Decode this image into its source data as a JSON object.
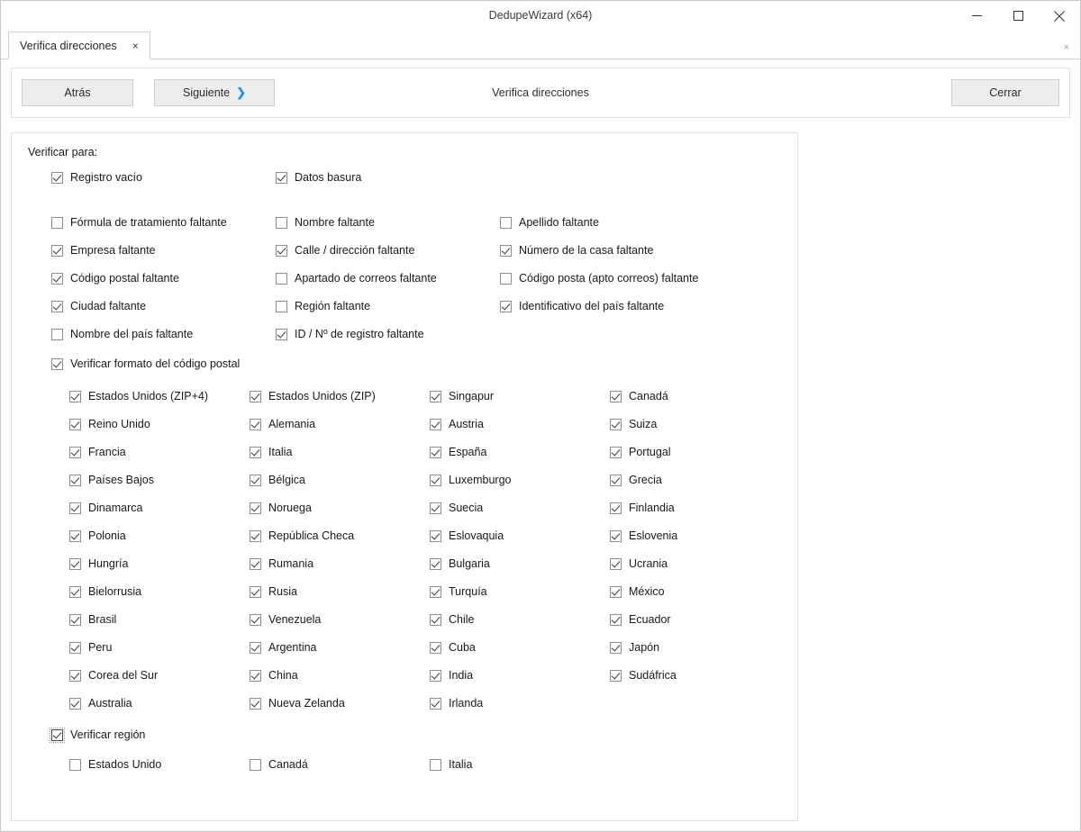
{
  "window": {
    "title": "DedupeWizard  (x64)",
    "minimize_label": "minimize",
    "maximize_label": "maximize",
    "close_label": "close"
  },
  "tabstrip": {
    "tab_label": "Verifica direcciones",
    "tab_close": "×",
    "strip_close": "×"
  },
  "toolbar": {
    "back_label": "Atrás",
    "next_label": "Siguiente",
    "next_chevron": "❯",
    "title": "Verifica direcciones",
    "close_label": "Cerrar"
  },
  "main": {
    "verify_for_label": "Verificar para:",
    "top_checks": [
      {
        "label": "Registro vacío",
        "checked": true
      },
      {
        "label": "Datos basura",
        "checked": true
      },
      {
        "label": "",
        "checked": null
      },
      {
        "label": "Fórmula de tratamiento faltante",
        "checked": false
      },
      {
        "label": "Nombre faltante",
        "checked": false
      },
      {
        "label": "Apellido faltante",
        "checked": false
      },
      {
        "label": "Empresa faltante",
        "checked": true
      },
      {
        "label": "Calle / dirección faltante",
        "checked": true
      },
      {
        "label": "Número de la casa faltante",
        "checked": true
      },
      {
        "label": "Código postal faltante",
        "checked": true
      },
      {
        "label": "Apartado de correos faltante",
        "checked": false
      },
      {
        "label": "Código posta (apto correos) faltante",
        "checked": false
      },
      {
        "label": "Ciudad faltante",
        "checked": true
      },
      {
        "label": "Región faltante",
        "checked": false
      },
      {
        "label": "Identificativo del país faltante",
        "checked": true
      },
      {
        "label": "Nombre del país faltante",
        "checked": false
      },
      {
        "label": "ID / Nº de registro faltante",
        "checked": true
      },
      {
        "label": "",
        "checked": null
      }
    ],
    "zip_format": {
      "label": "Verificar formato del código postal",
      "checked": true
    },
    "countries": [
      {
        "label": "Estados Unidos (ZIP+4)",
        "checked": true
      },
      {
        "label": "Estados Unidos (ZIP)",
        "checked": true
      },
      {
        "label": "Singapur",
        "checked": true
      },
      {
        "label": "Canadá",
        "checked": true
      },
      {
        "label": "Reino Unido",
        "checked": true
      },
      {
        "label": "Alemania",
        "checked": true
      },
      {
        "label": "Austria",
        "checked": true
      },
      {
        "label": "Suiza",
        "checked": true
      },
      {
        "label": "Francia",
        "checked": true
      },
      {
        "label": "Italia",
        "checked": true
      },
      {
        "label": "España",
        "checked": true
      },
      {
        "label": "Portugal",
        "checked": true
      },
      {
        "label": "Países Bajos",
        "checked": true
      },
      {
        "label": "Bélgica",
        "checked": true
      },
      {
        "label": "Luxemburgo",
        "checked": true
      },
      {
        "label": "Grecia",
        "checked": true
      },
      {
        "label": "Dinamarca",
        "checked": true
      },
      {
        "label": "Noruega",
        "checked": true
      },
      {
        "label": "Suecia",
        "checked": true
      },
      {
        "label": "Finlandia",
        "checked": true
      },
      {
        "label": "Polonia",
        "checked": true
      },
      {
        "label": "República Checa",
        "checked": true
      },
      {
        "label": "Eslovaquia",
        "checked": true
      },
      {
        "label": "Eslovenia",
        "checked": true
      },
      {
        "label": "Hungría",
        "checked": true
      },
      {
        "label": "Rumania",
        "checked": true
      },
      {
        "label": "Bulgaria",
        "checked": true
      },
      {
        "label": "Ucrania",
        "checked": true
      },
      {
        "label": "Bielorrusia",
        "checked": true
      },
      {
        "label": "Rusia",
        "checked": true
      },
      {
        "label": "Turquía",
        "checked": true
      },
      {
        "label": "México",
        "checked": true
      },
      {
        "label": "Brasil",
        "checked": true
      },
      {
        "label": "Venezuela",
        "checked": true
      },
      {
        "label": "Chile",
        "checked": true
      },
      {
        "label": "Ecuador",
        "checked": true
      },
      {
        "label": "Peru",
        "checked": true
      },
      {
        "label": "Argentina",
        "checked": true
      },
      {
        "label": "Cuba",
        "checked": true
      },
      {
        "label": "Japón",
        "checked": true
      },
      {
        "label": "Corea del Sur",
        "checked": true
      },
      {
        "label": "China",
        "checked": true
      },
      {
        "label": "India",
        "checked": true
      },
      {
        "label": "Sudáfrica",
        "checked": true
      },
      {
        "label": "Australia",
        "checked": true
      },
      {
        "label": "Nueva Zelanda",
        "checked": true
      },
      {
        "label": "Irlanda",
        "checked": true
      },
      {
        "label": "",
        "checked": null
      }
    ],
    "verify_region": {
      "label": "Verificar región",
      "checked": true,
      "focused": true
    },
    "regions": [
      {
        "label": "Estados Unido",
        "checked": false
      },
      {
        "label": "Canadá",
        "checked": false
      },
      {
        "label": "Italia",
        "checked": false
      }
    ]
  }
}
